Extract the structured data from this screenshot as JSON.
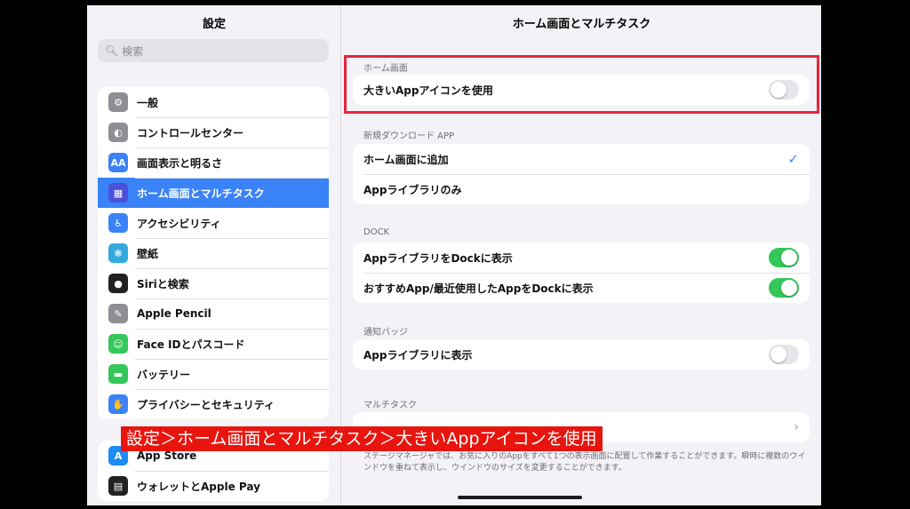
{
  "sidebar": {
    "title": "設定",
    "search_placeholder": "検索",
    "group1": [
      {
        "label": "一般",
        "icon": "gear-icon",
        "glyph": "⚙",
        "color": "#8e8e93"
      },
      {
        "label": "コントロールセンター",
        "icon": "control-center-icon",
        "glyph": "◐",
        "color": "#8e8e93"
      },
      {
        "label": "画面表示と明るさ",
        "icon": "display-brightness-icon",
        "glyph": "AA",
        "color": "#3a82f7"
      },
      {
        "label": "ホーム画面とマルチタスク",
        "icon": "home-screen-grid-icon",
        "glyph": "▦",
        "color": "#4b50d8",
        "selected": true
      },
      {
        "label": "アクセシビリティ",
        "icon": "accessibility-icon",
        "glyph": "♿",
        "color": "#3a82f7"
      },
      {
        "label": "壁紙",
        "icon": "wallpaper-icon",
        "glyph": "❋",
        "color": "#34aadc"
      },
      {
        "label": "Siriと検索",
        "icon": "siri-icon",
        "glyph": "●",
        "color": "#222222"
      },
      {
        "label": "Apple Pencil",
        "icon": "pencil-icon",
        "glyph": "✎",
        "color": "#8e8e93"
      },
      {
        "label": "Face IDとパスコード",
        "icon": "face-id-icon",
        "glyph": "☺",
        "color": "#34c759"
      },
      {
        "label": "バッテリー",
        "icon": "battery-icon",
        "glyph": "▬",
        "color": "#34c759"
      },
      {
        "label": "プライバシーとセキュリティ",
        "icon": "privacy-hand-icon",
        "glyph": "✋",
        "color": "#3a82f7"
      }
    ],
    "group2": [
      {
        "label": "App Store",
        "icon": "app-store-icon",
        "glyph": "A",
        "color": "#1e8cf5"
      },
      {
        "label": "ウォレットとApple Pay",
        "icon": "wallet-icon",
        "glyph": "▤",
        "color": "#222222"
      }
    ]
  },
  "main": {
    "title": "ホーム画面とマルチタスク",
    "sections": {
      "home_screen": {
        "label": "ホーム画面",
        "rows": [
          {
            "label": "大きいAppアイコンを使用",
            "toggle": false
          }
        ]
      },
      "new_downloads": {
        "label": "新規ダウンロード APP",
        "rows": [
          {
            "label": "ホーム画面に追加",
            "checked": true
          },
          {
            "label": "Appライブラリのみ",
            "checked": false
          }
        ]
      },
      "dock": {
        "label": "DOCK",
        "rows": [
          {
            "label": "AppライブラリをDockに表示",
            "toggle": true
          },
          {
            "label": "おすすめApp/最近使用したAppをDockに表示",
            "toggle": true
          }
        ]
      },
      "badges": {
        "label": "通知バッジ",
        "rows": [
          {
            "label": "Appライブラリに表示",
            "toggle": false
          }
        ]
      },
      "multitask": {
        "label": "マルチタスク"
      }
    },
    "footnote": "ステージマネージャでは、お気に入りのAppをすべて1つの表示画面に配置して作業することができます。瞬時に複数のウインドウを重ねて表示し、ウインドウのサイズを変更することができます。"
  },
  "caption": "設定＞ホーム画面とマルチタスク＞大きいAppアイコンを使用",
  "colors": {
    "accent": "#3a82f7",
    "toggle_on": "#34c759",
    "highlight": "#e8253c",
    "caption_bg": "#e8150f"
  }
}
